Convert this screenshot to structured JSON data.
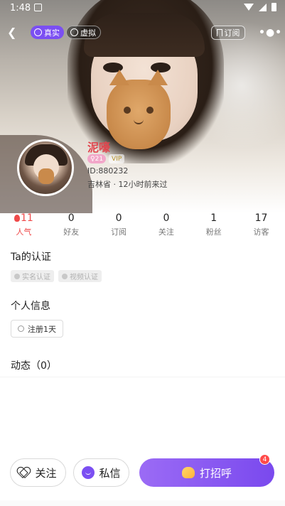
{
  "status_bar": {
    "time": "1:48"
  },
  "top_bar": {
    "tag_real": "真实",
    "tag_virtual": "虚拟",
    "subscribe_label": "订阅",
    "more_label": "•●•"
  },
  "profile": {
    "nickname": "泥嚎",
    "age_badge": "♀21",
    "vip_badge": "VIP",
    "id_text": "ID:880232",
    "location_text": "吉林省 · 12小时前来过"
  },
  "stats": [
    {
      "value": "11",
      "label": "人气"
    },
    {
      "value": "0",
      "label": "好友"
    },
    {
      "value": "0",
      "label": "订阅"
    },
    {
      "value": "0",
      "label": "关注"
    },
    {
      "value": "1",
      "label": "粉丝"
    },
    {
      "value": "17",
      "label": "访客"
    }
  ],
  "certification": {
    "title": "Ta的认证",
    "items": [
      "实名认证",
      "视频认证"
    ]
  },
  "personal_info": {
    "title": "个人信息",
    "registered": "注册1天"
  },
  "moments": {
    "title": "动态（0）"
  },
  "bottom_bar": {
    "follow_label": "关注",
    "message_label": "私信",
    "greet_label": "打招呼",
    "greet_badge": "4"
  },
  "colors": {
    "accent_purple": "#7b4ff2",
    "hot_red": "#ef4a4a",
    "nickname_red": "#e0464e"
  }
}
